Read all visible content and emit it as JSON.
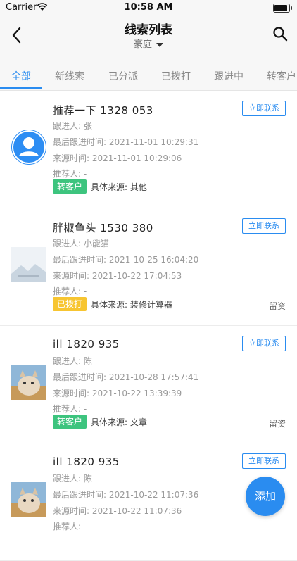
{
  "status_bar": {
    "carrier": "Carrier",
    "time": "10:58 AM"
  },
  "nav": {
    "title": "线索列表",
    "subtitle": "豪庭",
    "back_icon": "chevron-left-icon",
    "search_icon": "search-icon"
  },
  "tabs": [
    {
      "label": "全部",
      "active": true
    },
    {
      "label": "新线索",
      "active": false
    },
    {
      "label": "已分派",
      "active": false
    },
    {
      "label": "已拨打",
      "active": false
    },
    {
      "label": "跟进中",
      "active": false
    },
    {
      "label": "转客户",
      "active": false
    }
  ],
  "items": [
    {
      "name": "推荐一下  1328        053",
      "follower": "跟进人: 张",
      "last_follow": "最后跟进时间:  2021-11-01 10:29:31",
      "source_time": "来源时间:  2021-11-01 10:29:06",
      "referrer": "推荐人: -",
      "tag": "转客户",
      "tag_color": "#3dc47e",
      "source": "具体来源:  其他",
      "leave": "",
      "contact": "立即联系",
      "avatar": "default-user-avatar"
    },
    {
      "name": "胖椒鱼头  1530       380",
      "follower": "跟进人: 小能猫",
      "last_follow": "最后跟进时间:  2021-10-25 16:04:20",
      "source_time": "来源时间:  2021-10-22 17:04:53",
      "referrer": "推荐人: -",
      "tag": "已拨打",
      "tag_color": "#f7c531",
      "source": "具体来源:  装修计算器",
      "leave": "留资",
      "contact": "立即联系",
      "avatar": "placeholder-image"
    },
    {
      "name": "ill  1820       935",
      "follower": "跟进人: 陈",
      "last_follow": "最后跟进时间:  2021-10-28 17:57:41",
      "source_time": "来源时间:  2021-10-22 13:39:39",
      "referrer": "推荐人: -",
      "tag": "转客户",
      "tag_color": "#3dc47e",
      "source": "具体来源:  文章",
      "leave": "留资",
      "contact": "立即联系",
      "avatar": "cat-photo"
    },
    {
      "name": "ill  1820       935",
      "follower": "跟进人: 陈",
      "last_follow": "最后跟进时间:  2021-10-22 11:07:36",
      "source_time": "来源时间:  2021-10-22 11:07:36",
      "referrer": "推荐人: -",
      "tag": "",
      "tag_color": "",
      "source": "",
      "leave": "",
      "contact": "立即联系",
      "avatar": "cat-photo"
    }
  ],
  "fab": {
    "label": "添加"
  }
}
